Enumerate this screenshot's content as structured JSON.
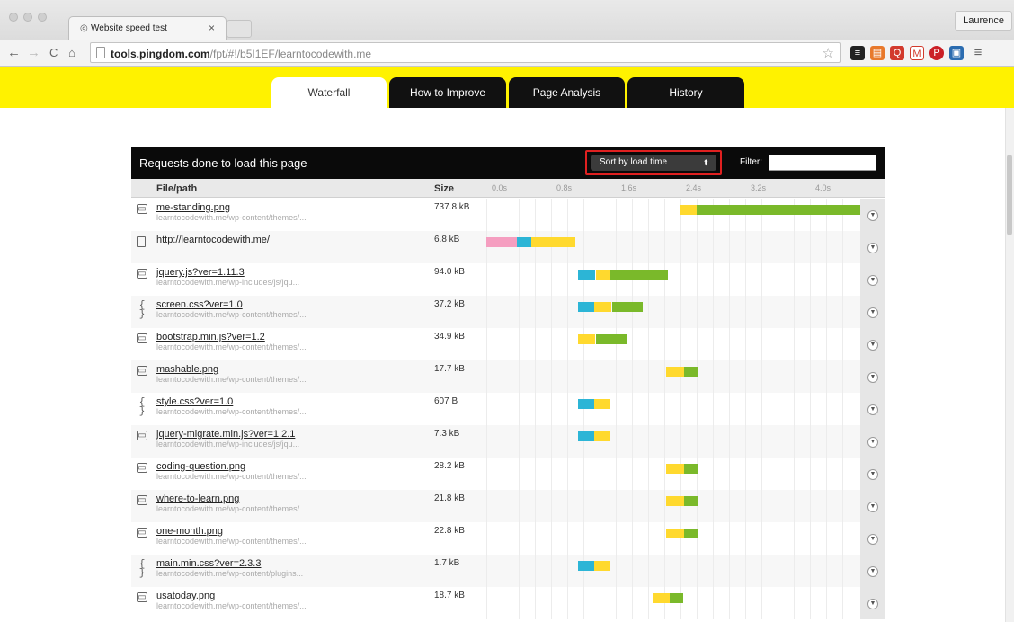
{
  "browser": {
    "tab_title": "Website speed test",
    "tab_close": "×",
    "profile_name": "Laurence",
    "url_domain": "tools.pingdom.com",
    "url_path": "/fpt/#!/b5I1EF/learntocodewith.me",
    "nav": {
      "back": "←",
      "forward": "→",
      "reload": "C",
      "home": "⌂"
    }
  },
  "tabs": [
    {
      "label": "Waterfall",
      "active": true
    },
    {
      "label": "How to Improve",
      "active": false
    },
    {
      "label": "Page Analysis",
      "active": false
    },
    {
      "label": "History",
      "active": false
    }
  ],
  "panel": {
    "title": "Requests done to load this page",
    "sort_value": "Sort by load time",
    "filter_label": "Filter:",
    "filter_value": ""
  },
  "columns": {
    "file": "File/path",
    "size": "Size",
    "ticks": [
      "0.0s",
      "0.8s",
      "1.6s",
      "2.4s",
      "3.2s",
      "4.0s"
    ]
  },
  "colors": {
    "dns": "#f59ec0",
    "connect": "#2cb5d6",
    "wait": "#ffd92e",
    "receive": "#7ab92a",
    "brand_yellow": "#fff200"
  },
  "requests": [
    {
      "icon": "img",
      "name": "me-standing.png",
      "path": "learntocodewith.me/wp-content/themes/...",
      "size": "737.8 kB",
      "timing": [
        [
          "wait",
          2.4,
          0.2
        ],
        [
          "receive",
          2.6,
          2.38
        ]
      ]
    },
    {
      "icon": "doc",
      "name": "http://learntocodewith.me/",
      "path": "",
      "size": "6.8 kB",
      "timing": [
        [
          "dns",
          0.0,
          0.38
        ],
        [
          "connect",
          0.38,
          0.18
        ],
        [
          "wait",
          0.56,
          0.54
        ]
      ]
    },
    {
      "icon": "img",
      "name": "jquery.js?ver=1.11.3",
      "path": "learntocodewith.me/wp-includes/js/jqu...",
      "size": "94.0 kB",
      "timing": [
        [
          "connect",
          1.13,
          0.22
        ],
        [
          "wait",
          1.35,
          0.18
        ],
        [
          "receive",
          1.53,
          0.72
        ]
      ]
    },
    {
      "icon": "css",
      "name": "screen.css?ver=1.0",
      "path": "learntocodewith.me/wp-content/themes/...",
      "size": "37.2 kB",
      "timing": [
        [
          "connect",
          1.13,
          0.2
        ],
        [
          "wait",
          1.33,
          0.22
        ],
        [
          "receive",
          1.55,
          0.38
        ]
      ]
    },
    {
      "icon": "img",
      "name": "bootstrap.min.js?ver=1.2",
      "path": "learntocodewith.me/wp-content/themes/...",
      "size": "34.9 kB",
      "timing": [
        [
          "wait",
          1.13,
          0.22
        ],
        [
          "receive",
          1.35,
          0.38
        ]
      ]
    },
    {
      "icon": "img",
      "name": "mashable.png",
      "path": "learntocodewith.me/wp-content/themes/...",
      "size": "17.7 kB",
      "timing": [
        [
          "wait",
          2.22,
          0.22
        ],
        [
          "receive",
          2.44,
          0.18
        ]
      ]
    },
    {
      "icon": "css",
      "name": "style.css?ver=1.0",
      "path": "learntocodewith.me/wp-content/themes/...",
      "size": "607 B",
      "timing": [
        [
          "connect",
          1.13,
          0.2
        ],
        [
          "wait",
          1.33,
          0.2
        ]
      ]
    },
    {
      "icon": "img",
      "name": "jquery-migrate.min.js?ver=1.2.1",
      "path": "learntocodewith.me/wp-includes/js/jqu...",
      "size": "7.3 kB",
      "timing": [
        [
          "connect",
          1.13,
          0.2
        ],
        [
          "wait",
          1.33,
          0.2
        ]
      ]
    },
    {
      "icon": "img",
      "name": "coding-question.png",
      "path": "learntocodewith.me/wp-content/themes/...",
      "size": "28.2 kB",
      "timing": [
        [
          "wait",
          2.22,
          0.22
        ],
        [
          "receive",
          2.44,
          0.18
        ]
      ]
    },
    {
      "icon": "img",
      "name": "where-to-learn.png",
      "path": "learntocodewith.me/wp-content/themes/...",
      "size": "21.8 kB",
      "timing": [
        [
          "wait",
          2.22,
          0.22
        ],
        [
          "receive",
          2.44,
          0.18
        ]
      ]
    },
    {
      "icon": "img",
      "name": "one-month.png",
      "path": "learntocodewith.me/wp-content/themes/...",
      "size": "22.8 kB",
      "timing": [
        [
          "wait",
          2.22,
          0.22
        ],
        [
          "receive",
          2.44,
          0.18
        ]
      ]
    },
    {
      "icon": "css",
      "name": "main.min.css?ver=2.3.3",
      "path": "learntocodewith.me/wp-content/plugins...",
      "size": "1.7 kB",
      "timing": [
        [
          "connect",
          1.13,
          0.2
        ],
        [
          "wait",
          1.33,
          0.2
        ]
      ]
    },
    {
      "icon": "img",
      "name": "usatoday.png",
      "path": "learntocodewith.me/wp-content/themes/...",
      "size": "18.7 kB",
      "timing": [
        [
          "wait",
          2.05,
          0.22
        ],
        [
          "receive",
          2.27,
          0.16
        ]
      ]
    }
  ]
}
